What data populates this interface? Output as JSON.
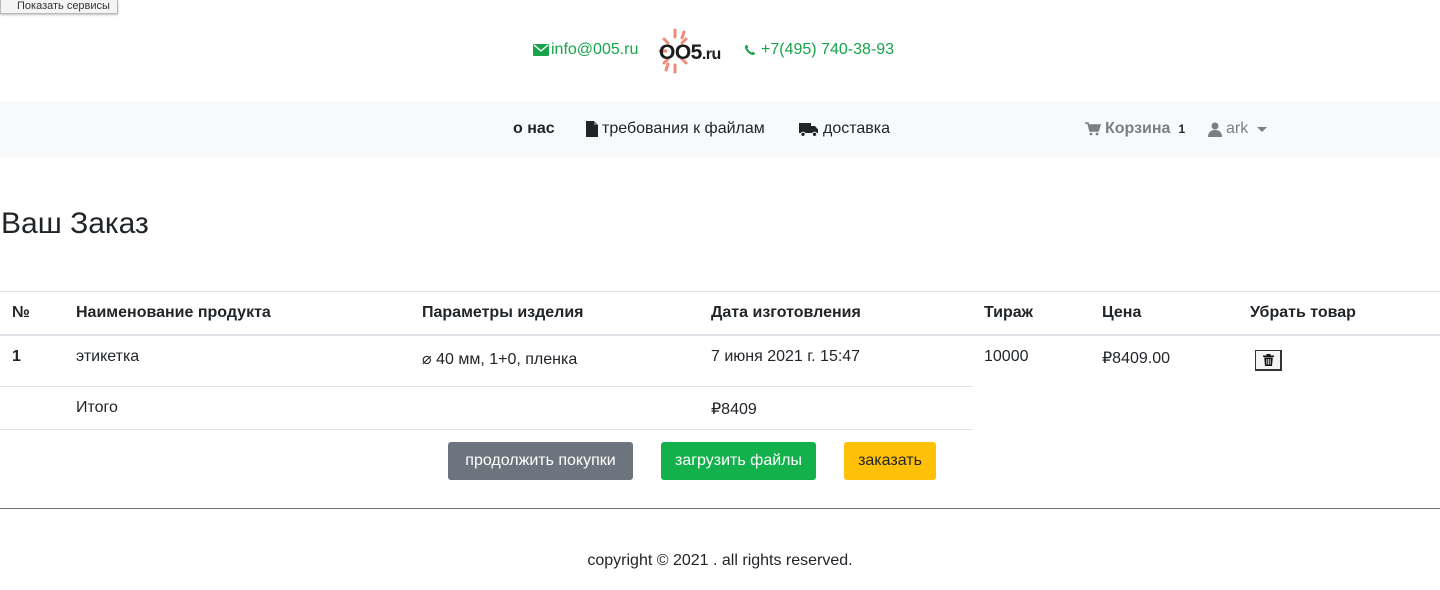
{
  "tooltip": "Показать сервисы",
  "header": {
    "email": "info@005.ru",
    "logo_main": "OO5",
    "logo_suffix": ".ru",
    "phone": "+7(495) 740-38-93"
  },
  "nav": {
    "about": "о нас",
    "files": "требования к файлам",
    "delivery": "доставка",
    "cart_label": "Корзина",
    "cart_count": "1",
    "user": "ark"
  },
  "page_title": "Ваш Заказ",
  "table": {
    "columns": [
      "№",
      "Наименование продукта",
      "Параметры изделия",
      "Дата изготовления",
      "Тираж",
      "Цена",
      "Убрать товар"
    ],
    "rows": [
      {
        "num": "1",
        "product": "этикетка",
        "params": "⌀ 40 мм, 1+0, пленка",
        "date": "7 июня 2021 г. 15:47",
        "quantity": "10000",
        "price": "₽8409.00"
      }
    ],
    "total_label": "Итого",
    "total_value": "₽8409"
  },
  "buttons": {
    "continue": "продолжить покупки",
    "upload": "загрузить файлы",
    "order": "заказать"
  },
  "footer": {
    "copyright": "copyright © 2021 . all rights reserved."
  },
  "colors": {
    "accent_green": "#17a44a",
    "navbar_bg": "#f8f9fa",
    "btn_secondary": "#6c757d",
    "btn_success": "#12b14b",
    "btn_warning": "#ffc107"
  }
}
